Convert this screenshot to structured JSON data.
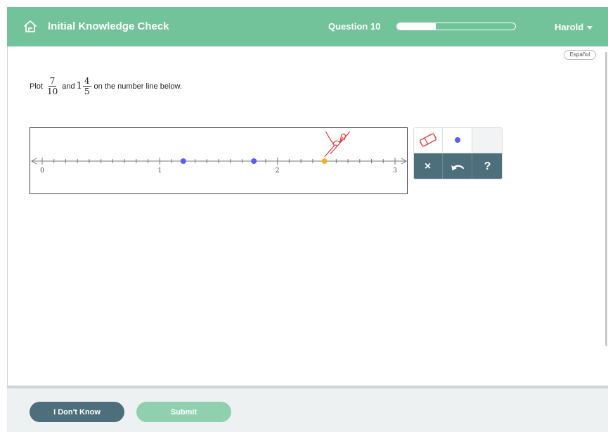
{
  "header": {
    "title": "Initial Knowledge Check",
    "question_label": "Question 10",
    "progress_fraction": 0.33,
    "user_name": "Harold"
  },
  "language_toggle": "Español",
  "prompt": {
    "prefix": "Plot",
    "frac1_num": "7",
    "frac1_den": "10",
    "middle": "and",
    "mixed_whole": "1",
    "frac2_num": "4",
    "frac2_den": "5",
    "suffix": "on the number line below."
  },
  "number_line": {
    "min": 0,
    "max": 3,
    "divisions_per_unit": 10,
    "labels": [
      "0",
      "1",
      "2",
      "3"
    ],
    "points": [
      {
        "value": 1.2,
        "color": "#5b5ef0"
      },
      {
        "value": 1.8,
        "color": "#5b5ef0"
      },
      {
        "value": 2.4,
        "color": "#f5b321"
      }
    ]
  },
  "tools": {
    "eraser": "eraser-icon",
    "point": "point-icon",
    "clear": "×",
    "undo": "undo-icon",
    "help": "?"
  },
  "footer": {
    "dont_know": "I Don't Know",
    "submit": "Submit"
  },
  "colors": {
    "header": "#72c39a",
    "dark_button": "#4d6e7b",
    "submit_button": "#8fd1ae",
    "point_blue": "#5b5ef0",
    "point_orange": "#f5b321"
  }
}
